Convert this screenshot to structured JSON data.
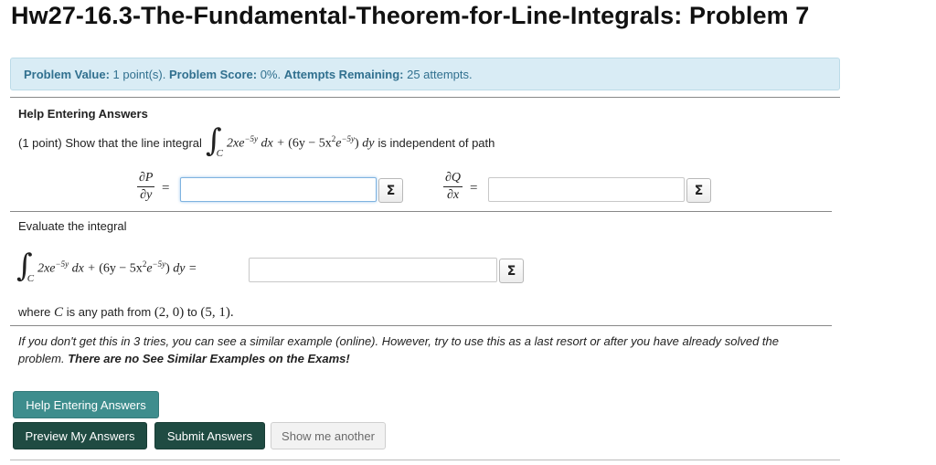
{
  "page": {
    "title": "Hw27-16.3-The-Fundamental-Theorem-for-Line-Integrals: Problem 7"
  },
  "info_bar": {
    "value_label": "Problem Value:",
    "value_text": "1 point(s).",
    "score_label": "Problem Score:",
    "score_text": "0%.",
    "attempts_label": "Attempts Remaining:",
    "attempts_text": "25 attempts."
  },
  "problem": {
    "help_heading": "Help Entering Answers",
    "points": "(1 point)",
    "statement_start": "Show that the line integral",
    "statement_end": "is independent of path",
    "integral_sub": "C",
    "integrand_p": "2xe",
    "integrand_p_exp": "−5y",
    "dx": "dx +",
    "integrand_q_open": "(6y − 5x",
    "integrand_q_sq": "2",
    "integrand_q_e": "e",
    "integrand_q_exp": "−5y",
    "integrand_q_close": ")",
    "dy": "dy",
    "dy_equals": "dy =",
    "dP_num": "∂P",
    "dP_den": "∂y",
    "dQ_num": "∂Q",
    "dQ_den": "∂x",
    "equals": "=",
    "evaluate_label": "Evaluate the integral",
    "where_prefix": "where",
    "where_C": "C",
    "where_middle": "is any path from",
    "point_a": "(2, 0)",
    "to": "to",
    "point_b": "(5, 1)."
  },
  "inputs": {
    "dP_dy": "",
    "dQ_dx": "",
    "integral_value": ""
  },
  "equation_editor_glyph": "Σ",
  "hint": {
    "text": "If you don't get this in 3 tries, you can see a similar example (online). However, try to use this as a last resort or after you have already solved the problem.",
    "bold": "There are no See Similar Examples on the Exams!"
  },
  "buttons": {
    "help": "Help Entering Answers",
    "preview": "Preview My Answers",
    "submit": "Submit Answers",
    "another": "Show me another"
  },
  "colors": {
    "info_bg": "#d9ecf5",
    "info_text": "#31708f",
    "help_button": "#3e8d8d",
    "primary_button": "#1f4b42"
  }
}
